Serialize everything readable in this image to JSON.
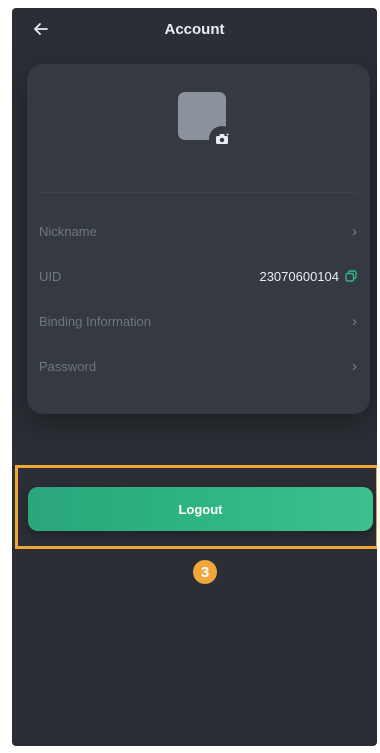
{
  "header": {
    "title": "Account",
    "back_icon": "arrow-left-icon"
  },
  "profile": {
    "avatar_icon": "avatar-placeholder",
    "camera_icon": "camera-icon"
  },
  "rows": [
    {
      "label": "Nickname",
      "value": "",
      "action_icon": "chevron-right-icon"
    },
    {
      "label": "UID",
      "value": "23070600104",
      "action_icon": "copy-icon"
    },
    {
      "label": "Binding Information",
      "value": "",
      "action_icon": "chevron-right-icon"
    },
    {
      "label": "Password",
      "value": "",
      "action_icon": "chevron-right-icon"
    }
  ],
  "logout": {
    "label": "Logout"
  },
  "annotation": {
    "step_number": "3"
  },
  "colors": {
    "background": "#2b2f35",
    "card": "#343942",
    "accent": "#2fb683",
    "highlight": "#f0a63a"
  }
}
